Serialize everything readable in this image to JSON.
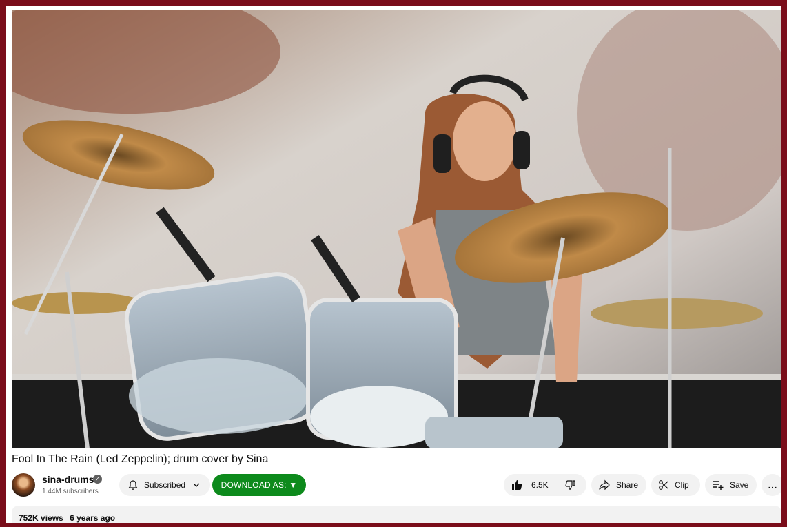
{
  "video": {
    "title": "Fool In The Rain (Led Zeppelin); drum cover by Sina"
  },
  "channel": {
    "name": "sina-drums",
    "subscribers": "1.44M subscribers",
    "verified_icon": "verified-check-icon"
  },
  "actions": {
    "subscribed_label": "Subscribed",
    "download_label": "DOWNLOAD AS: ▼",
    "like_count": "6.5K",
    "share_label": "Share",
    "clip_label": "Clip",
    "save_label": "Save",
    "more_label": "…"
  },
  "description": {
    "views": "752K views",
    "age": "6 years ago"
  },
  "colors": {
    "page_border": "#7a0d1a",
    "download_button": "#0d8a1c",
    "pill_bg": "#f2f2f2"
  }
}
